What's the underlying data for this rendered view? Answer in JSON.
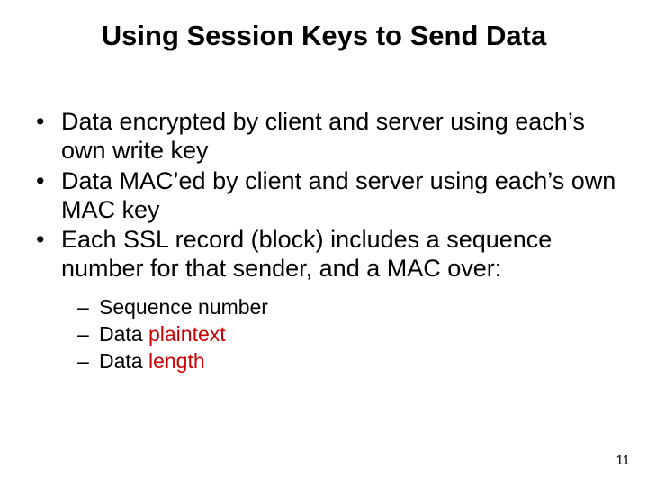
{
  "title": "Using Session Keys to Send Data",
  "bullets": [
    {
      "text": "Data encrypted by client and server using each’s own write key"
    },
    {
      "text": "Data MAC’ed by client and server using each’s own MAC key"
    },
    {
      "text": "Each SSL record (block) includes a sequence number for that sender, and a MAC over:"
    }
  ],
  "subbullets": [
    {
      "prefix": "Sequence number",
      "highlight": ""
    },
    {
      "prefix": "Data ",
      "highlight": "plaintext"
    },
    {
      "prefix": "Data ",
      "highlight": "length"
    }
  ],
  "page_number": "11"
}
